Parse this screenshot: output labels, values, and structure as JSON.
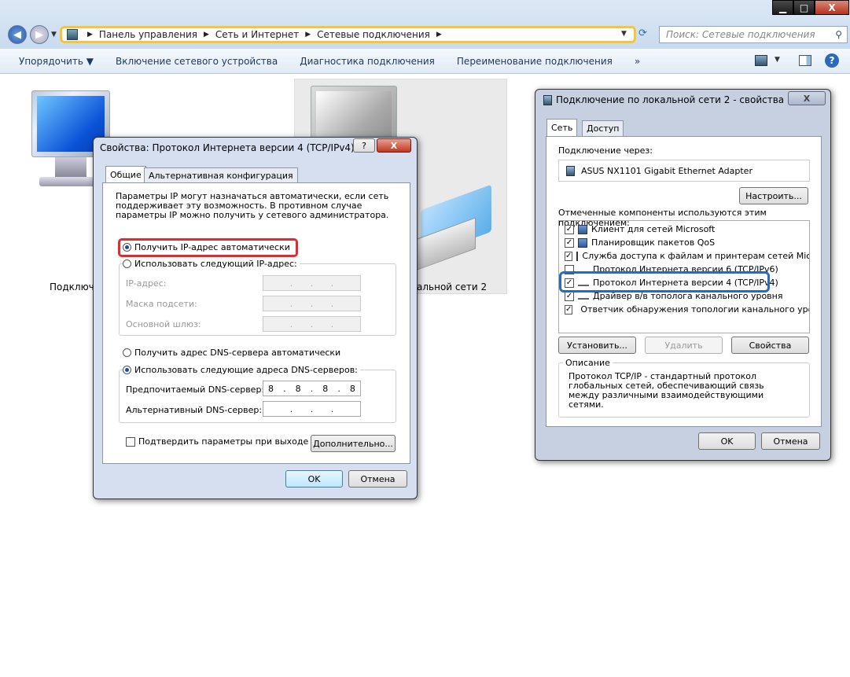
{
  "window": {
    "min": "▁",
    "max": "□",
    "close": "X"
  },
  "breadcrumb": [
    "Панель управления",
    "Сетевые подключения",
    "Сеть и Интернет"
  ],
  "breadcrumb_order": [
    "Панель управления",
    "Сеть и Интернет",
    "Сетевые подключения"
  ],
  "search": {
    "placeholder": "Поиск: Сетевые подключения"
  },
  "toolbar": {
    "organize": "Упорядочить ▼",
    "enable": "Включение сетевого устройства",
    "diagnose": "Диагностика подключения",
    "rename": "Переименование подключения",
    "more": "»"
  },
  "connections": {
    "left_label": "Подключ",
    "right_label": "альной сети 2"
  },
  "ipv4": {
    "title": "Свойства: Протокол Интернета версии 4 (TCP/IPv4)",
    "help": "?",
    "close": "X",
    "tab_general": "Общие",
    "tab_alt": "Альтернативная конфигурация",
    "desc": "Параметры IP могут назначаться автоматически, если сеть поддерживает эту возможность. В противном случае параметры IP можно получить у сетевого администратора.",
    "auto_ip": "Получить IP-адрес автоматически",
    "manual_ip": "Использовать следующий IP-адрес:",
    "ip_label": "IP-адрес:",
    "mask_label": "Маска подсети:",
    "gateway_label": "Основной шлюз:",
    "auto_dns": "Получить адрес DNS-сервера автоматически",
    "manual_dns": "Использовать следующие адреса DNS-серверов:",
    "pref_dns_label": "Предпочитаемый DNS-сервер:",
    "pref_dns": [
      "8",
      "8",
      "8",
      "8"
    ],
    "alt_dns_label": "Альтернативный DNS-сервер:",
    "validate": "Подтвердить параметры при выходе",
    "advanced": "Дополнительно...",
    "ok": "OK",
    "cancel": "Отмена",
    "dot": "."
  },
  "lan": {
    "title": "Подключение по локальной сети 2 - свойства",
    "close": "X",
    "tab_net": "Сеть",
    "tab_access": "Доступ",
    "connect_via": "Подключение через:",
    "adapter": "ASUS NX1101 Gigabit Ethernet Adapter",
    "configure": "Настроить...",
    "components_label": "Отмеченные компоненты используются этим подключением:",
    "components": [
      {
        "label": "Клиент для сетей Microsoft",
        "checked": true
      },
      {
        "label": "Планировщик пакетов QoS",
        "checked": true
      },
      {
        "label": "Служба доступа к файлам и принтерам сетей Micro...",
        "checked": true
      },
      {
        "label": "Протокол Интернета версии 6 (TCP/IPv6)",
        "checked": false
      },
      {
        "label": "Протокол Интернета версии 4 (TCP/IPv4)",
        "checked": true
      },
      {
        "label": "Драйвер в/в тополога канального уровня",
        "checked": true
      },
      {
        "label": "Ответчик обнаружения топологии канального уровня",
        "checked": true
      }
    ],
    "install": "Установить...",
    "remove": "Удалить",
    "properties": "Свойства",
    "desc_title": "Описание",
    "desc": "Протокол TCP/IP - стандартный протокол глобальных сетей, обеспечивающий связь между различными взаимодействующими сетями.",
    "ok": "OK",
    "cancel": "Отмена"
  },
  "colors": {
    "highlight_red": "#d83030",
    "highlight_blue": "#2a6ab8",
    "highlight_yellow": "#f5c53a"
  }
}
